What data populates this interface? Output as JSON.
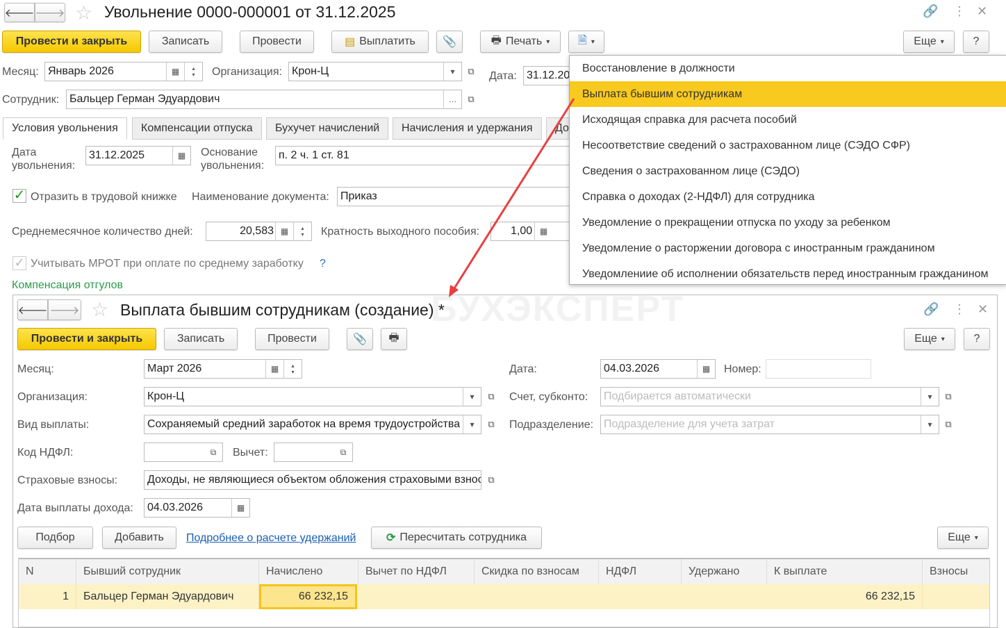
{
  "main": {
    "title": "Увольнение 0000-000001 от 31.12.2025",
    "toolbar": {
      "post_close": "Провести и закрыть",
      "save": "Записать",
      "post": "Провести",
      "pay": "Выплатить",
      "print": "Печать",
      "more": "Еще",
      "help": "?"
    },
    "month_label": "Месяц:",
    "month": "Январь 2026",
    "org_label": "Организация:",
    "org": "Крон-Ц",
    "date_label": "Дата:",
    "date": "31.12.20",
    "employee_label": "Сотрудник:",
    "employee": "Бальцер Герман Эдуардович",
    "tabs": [
      "Условия увольнения",
      "Компенсации отпуска",
      "Бухучет начислений",
      "Начисления и удержания",
      "До"
    ],
    "dismissal_date_label1": "Дата",
    "dismissal_date_label2": "увольнения:",
    "dismissal_date": "31.12.2025",
    "basis_label1": "Основание",
    "basis_label2": "увольнения:",
    "basis": "п. 2 ч. 1 ст. 81",
    "workbook_check": "Отразить в трудовой книжке",
    "doc_name_label": "Наименование документа:",
    "doc_name": "Приказ",
    "avg_days_label": "Среднемесячное количество дней:",
    "avg_days": "20,583",
    "multiplicity_label": "Кратность выходного пособия:",
    "multiplicity": "1,00",
    "mrot_check": "Учитывать МРОТ при оплате по среднему заработку",
    "mrot_help": "?",
    "comp_link": "Компенсация отгулов"
  },
  "menu": {
    "items": [
      "Восстановление в должности",
      "Выплата бывшим сотрудникам",
      "Исходящая справка для расчета пособий",
      "Несоответствие сведений о застрахованном лице (СЭДО СФР)",
      "Сведения о застрахованном лице (СЭДО)",
      "Справка о доходах (2-НДФЛ) для сотрудника",
      "Уведомление о прекращении отпуска по уходу за ребенком",
      "Уведомление о расторжении договора с иностранным гражданином",
      "Уведомлениие об исполнении обязательств перед иностранным гражданином"
    ],
    "selected": 1
  },
  "watermark": "БУХЭКСПЕРТ",
  "sub": {
    "title": "Выплата бывшим сотрудникам (создание) *",
    "toolbar": {
      "post_close": "Провести и закрыть",
      "save": "Записать",
      "post": "Провести",
      "more": "Еще",
      "help": "?"
    },
    "month_label": "Месяц:",
    "month": "Март 2026",
    "date_label": "Дата:",
    "date": "04.03.2026",
    "number_label": "Номер:",
    "number": "",
    "org_label": "Организация:",
    "org": "Крон-Ц",
    "account_label": "Счет, субконто:",
    "account_ph": "Подбирается автоматически",
    "pay_type_label": "Вид выплаты:",
    "pay_type": "Сохраняемый средний заработок на время трудоустройства",
    "dept_label": "Подразделение:",
    "dept_ph": "Подразделение для учета затрат",
    "ndfl_code_label": "Код НДФЛ:",
    "deduction_label": "Вычет:",
    "insurance_label": "Страховые взносы:",
    "insurance": "Доходы, не являющиеся объектом обложения страховыми взносами",
    "pay_date_label": "Дата выплаты дохода:",
    "pay_date": "04.03.2026",
    "select_btn": "Подбор",
    "add_btn": "Добавить",
    "details_link": "Подробнее о расчете удержаний",
    "recalc_btn": "Пересчитать сотрудника",
    "more2": "Еще",
    "table": {
      "columns": [
        "N",
        "Бывший сотрудник",
        "Начислено",
        "Вычет по НДФЛ",
        "Скидка по взносам",
        "НДФЛ",
        "Удержано",
        "К выплате",
        "Взносы"
      ],
      "rows": [
        [
          "1",
          "Бальцер Герман Эдуардович",
          "66 232,15",
          "",
          "",
          "",
          "",
          "66 232,15",
          ""
        ]
      ]
    }
  }
}
